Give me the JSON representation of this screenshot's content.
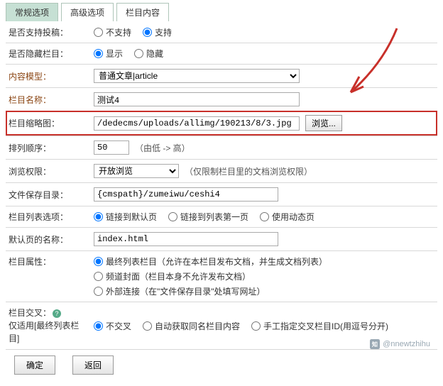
{
  "tabs": [
    "常规选项",
    "高级选项",
    "栏目内容"
  ],
  "rows": {
    "support_submit": {
      "label": "是否支持投稿：",
      "opts": [
        "不支持",
        "支持"
      ],
      "checked": 1
    },
    "hidden": {
      "label": "是否隐藏栏目：",
      "opts": [
        "显示",
        "隐藏"
      ],
      "checked": 0
    },
    "model": {
      "label": "内容模型：",
      "value": "普通文章|article"
    },
    "name": {
      "label": "栏目名称：",
      "value": "测试4"
    },
    "thumb": {
      "label": "栏目缩略图：",
      "value": "/dedecms/uploads/allimg/190213/8/3.jpg",
      "browse": "浏览..."
    },
    "sort": {
      "label": "排列顺序：",
      "value": "50",
      "hint": "（由低 -> 高）"
    },
    "perm": {
      "label": "浏览权限：",
      "value": "开放浏览",
      "hint": "（仅限制栏目里的文档浏览权限）"
    },
    "save_dir": {
      "label": "文件保存目录：",
      "value": "{cmspath}/zumeiwu/ceshi4"
    },
    "list_opt": {
      "label": "栏目列表选项：",
      "opts": [
        "链接到默认页",
        "链接到列表第一页",
        "使用动态页"
      ],
      "checked": 0
    },
    "default_page": {
      "label": "默认页的名称：",
      "value": "index.html"
    },
    "attr": {
      "label": "栏目属性：",
      "opts": [
        "最终列表栏目（允许在本栏目发布文档，并生成文档列表）",
        "频道封面（栏目本身不允许发布文档）",
        "外部连接（在\"文件保存目录\"处填写网址）"
      ],
      "checked": 0
    },
    "cross": {
      "label": "栏目交叉：",
      "sub": "仅适用[最终列表栏目]",
      "opts": [
        "不交叉",
        "自动获取同名栏目内容",
        "手工指定交叉栏目ID(用逗号分开)"
      ],
      "checked": 0
    }
  },
  "actions": {
    "confirm": "确定",
    "back": "返回"
  },
  "watermark": "@nnewtzhihu"
}
